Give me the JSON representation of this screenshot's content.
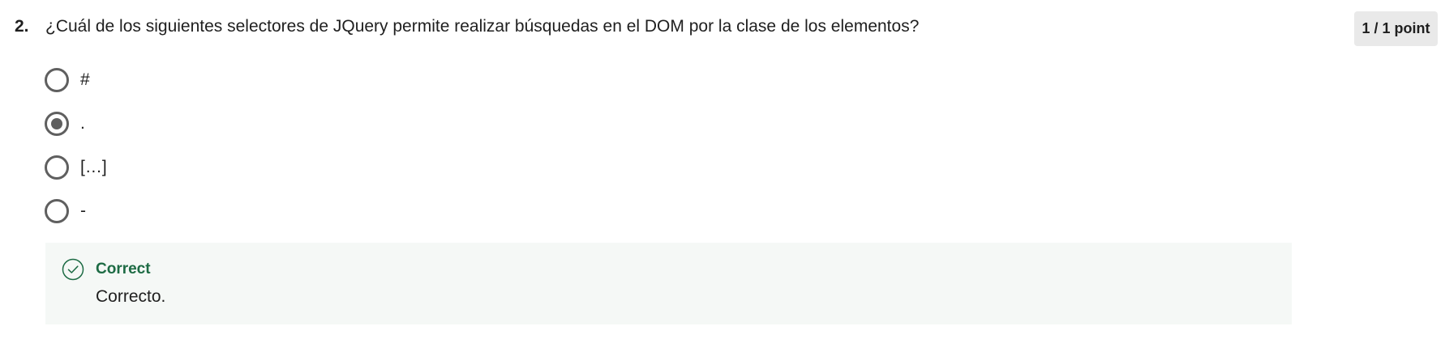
{
  "question": {
    "number": "2.",
    "text": "¿Cuál de los siguientes selectores de JQuery permite realizar búsquedas en el DOM por la clase de los elementos?",
    "points": "1 / 1 point"
  },
  "options": [
    {
      "label": "#",
      "selected": false
    },
    {
      "label": ".",
      "selected": true
    },
    {
      "label": "[…]",
      "selected": false
    },
    {
      "label": "-",
      "selected": false
    }
  ],
  "feedback": {
    "title": "Correct",
    "text": "Correcto.",
    "icon": "check-circle-icon",
    "accent_color": "#1d6b44",
    "background_color": "#f5f8f6"
  }
}
